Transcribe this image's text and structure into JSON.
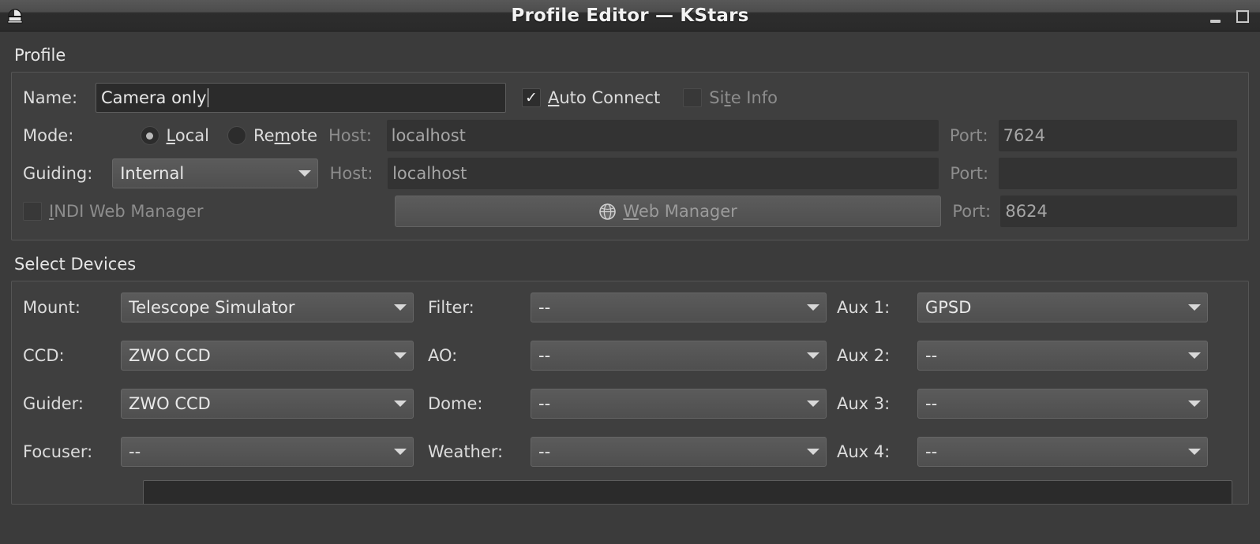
{
  "window": {
    "title": "Profile Editor — KStars",
    "icon": "observatory-dome-icon",
    "minimize_label": "",
    "maximize_label": ""
  },
  "profile": {
    "section_title": "Profile",
    "name_label": "Name:",
    "name_value": "Camera only",
    "auto_connect": {
      "label": "Auto Connect",
      "checked": true,
      "enabled": true,
      "mark": "✓"
    },
    "site_info": {
      "label": "Site Info",
      "checked": false,
      "enabled": false,
      "mark": ""
    },
    "mode_label": "Mode:",
    "mode_local": {
      "label": "Local",
      "selected": true
    },
    "mode_remote": {
      "label": "Remote",
      "selected": false
    },
    "mode_host_label": "Host:",
    "mode_host_value": "localhost",
    "mode_port_label": "Port:",
    "mode_port_value": "7624",
    "guiding_label": "Guiding:",
    "guiding_value": "Internal",
    "guiding_host_label": "Host:",
    "guiding_host_value": "localhost",
    "guiding_port_label": "Port:",
    "guiding_port_value": "",
    "indi_web_manager": {
      "label": "INDI Web Manager",
      "checked": false,
      "enabled": false
    },
    "web_manager_button": "Web Manager",
    "web_manager_icon": "globe-icon",
    "wm_port_label": "Port:",
    "wm_port_value": "8624"
  },
  "devices": {
    "section_title": "Select Devices",
    "rows": [
      {
        "c1_label": "Mount:",
        "c1_value": "Telescope Simulator",
        "c2_label": "Filter:",
        "c2_value": "--",
        "c3_label": "Aux 1:",
        "c3_value": "GPSD"
      },
      {
        "c1_label": "CCD:",
        "c1_value": "ZWO CCD",
        "c2_label": "AO:",
        "c2_value": "--",
        "c3_label": "Aux 2:",
        "c3_value": "--"
      },
      {
        "c1_label": "Guider:",
        "c1_value": "ZWO CCD",
        "c2_label": "Dome:",
        "c2_value": "--",
        "c3_label": "Aux 3:",
        "c3_value": "--"
      },
      {
        "c1_label": "Focuser:",
        "c1_value": "--",
        "c2_label": "Weather:",
        "c2_value": "--",
        "c3_label": "Aux 4:",
        "c3_value": "--"
      }
    ]
  },
  "colors": {
    "window_bg": "#3b3b3b",
    "titlebar_dark": "#2a2a2a",
    "input_bg": "#2b2b2b",
    "combo_bg": "#525252",
    "text": "#e6e6e6",
    "text_disabled": "#8d8d8d"
  }
}
